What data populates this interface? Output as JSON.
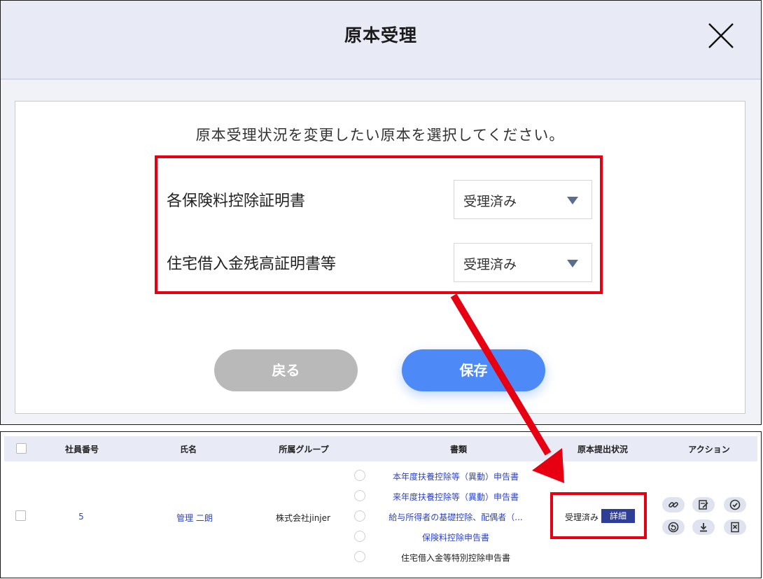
{
  "modal": {
    "title": "原本受理",
    "instruction": "原本受理状況を変更したい原本を選択してください。",
    "rows": [
      {
        "label": "各保険料控除証明書",
        "status": "受理済み"
      },
      {
        "label": "住宅借入金残高証明書等",
        "status": "受理済み"
      }
    ],
    "back_label": "戻る",
    "save_label": "保存"
  },
  "table": {
    "headers": {
      "employee_no": "社員番号",
      "name": "氏名",
      "group": "所属グループ",
      "documents": "書類",
      "original_status": "原本提出状況",
      "action": "アクション"
    },
    "row": {
      "employee_no": "5",
      "name": "管理 二朗",
      "group": "株式会社jinjer",
      "documents": [
        "本年度扶養控除等（異動）申告書",
        "来年度扶養控除等（異動）申告書",
        "給与所得者の基礎控除、配偶者（...",
        "保険料控除申告書",
        "住宅借入金等特別控除申告書"
      ],
      "status": "受理済み",
      "detail_label": "詳細"
    },
    "action_icons": [
      "link-icon",
      "edit-icon",
      "check-icon",
      "undo-icon",
      "download-icon",
      "document-icon"
    ]
  },
  "colors": {
    "highlight": "#e60012",
    "primary": "#4d8af7",
    "link": "#2f45c5",
    "detail_button": "#2e3d95",
    "header_bg": "#e8ebf6"
  }
}
